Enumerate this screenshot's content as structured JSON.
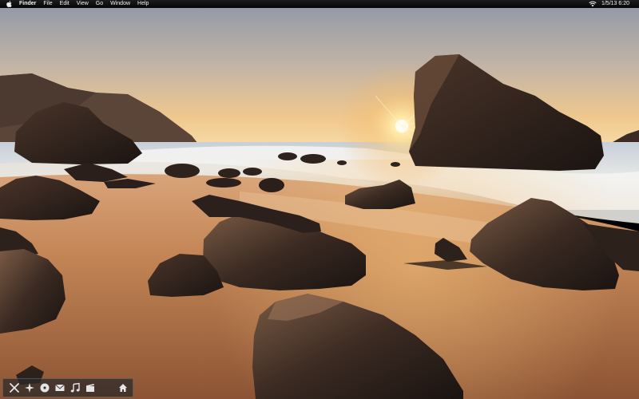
{
  "menubar": {
    "apple_icon": "apple-icon",
    "app_name": "Finder",
    "menus": [
      "File",
      "Edit",
      "View",
      "Go",
      "Window",
      "Help"
    ],
    "status": {
      "wifi_icon": "wifi-icon",
      "clock": "1/5/13  6:20"
    }
  },
  "dock": {
    "items": [
      {
        "icon": "x-app-icon"
      },
      {
        "icon": "compass-icon"
      },
      {
        "icon": "disc-icon"
      },
      {
        "icon": "mail-icon"
      },
      {
        "icon": "music-note-icon"
      },
      {
        "icon": "clapperboard-icon"
      },
      {
        "icon": "home-icon"
      }
    ]
  },
  "colors": {
    "menubar_bg": "#0d0d0d",
    "menubar_text": "#f2f2f2",
    "sky_top": "#8e96a6",
    "sky_horizon": "#f3cc8e",
    "sand": "#c98a5a",
    "rock": "#2a1f1a"
  }
}
